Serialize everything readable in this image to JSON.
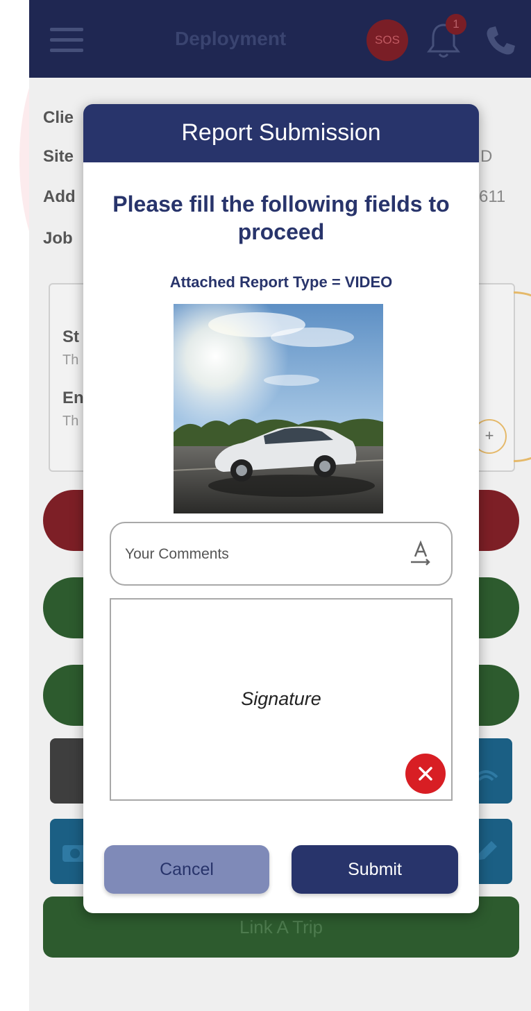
{
  "app_bar": {
    "title": "Deployment",
    "sos_label": "SOS",
    "notification_count": "1",
    "icons": [
      "menu-icon",
      "bell-icon",
      "phone-icon"
    ]
  },
  "background": {
    "row_labels": [
      "Clie",
      "Site",
      "Add",
      "Job"
    ],
    "row_tail_values": [
      "D",
      "611"
    ],
    "card": {
      "start_label": "St",
      "start_sub": "Th",
      "end_label": "En",
      "end_sub": "Th",
      "plus": "+"
    },
    "link_trip_label": "Link A Trip"
  },
  "modal": {
    "title": "Report Submission",
    "heading": "Please fill the following fields to proceed",
    "report_type": "Attached Report Type = VIDEO",
    "thumbnail": "car-on-road-sunny-sky",
    "comments_placeholder": "Your Comments",
    "comments_value": "",
    "signature_label": "Signature",
    "cancel_label": "Cancel",
    "submit_label": "Submit"
  },
  "colors": {
    "brand_navy": "#28346b",
    "cancel_button": "#7f8ab8",
    "clear_red": "#d81e24"
  }
}
